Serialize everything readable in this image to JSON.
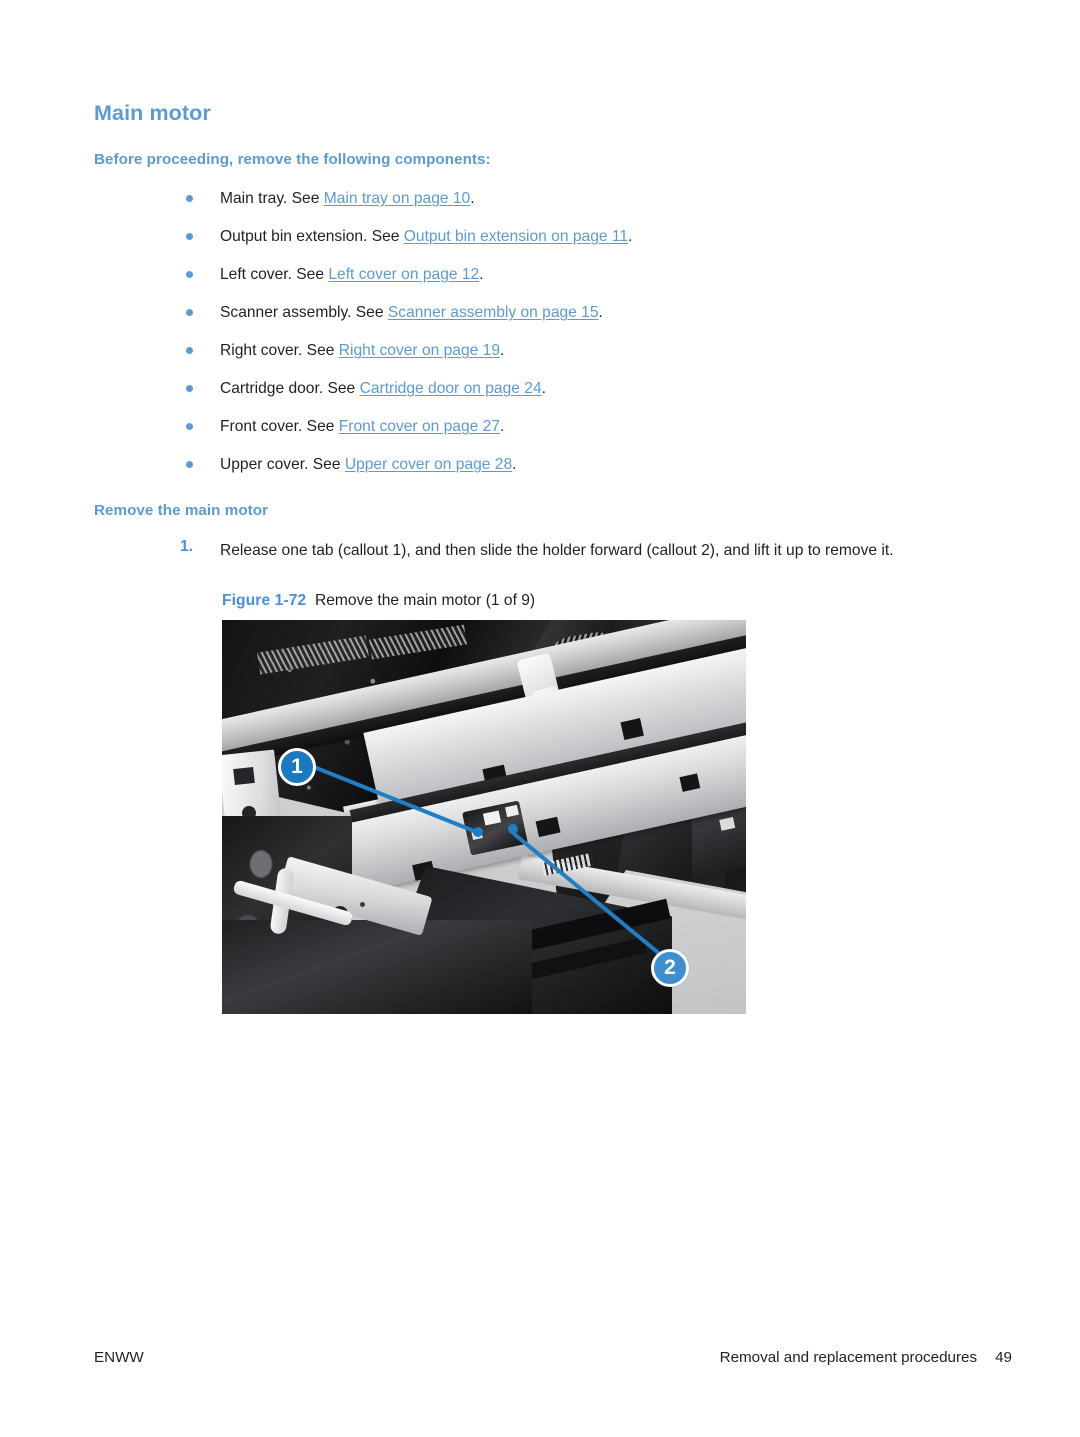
{
  "page": {
    "heading": "Main motor",
    "prereq_heading": "Before proceeding, remove the following components:",
    "remove_heading": "Remove the main motor"
  },
  "prerequisites": [
    {
      "lead": "Main tray. See ",
      "link": "Main tray on page 10",
      "tail": "."
    },
    {
      "lead": "Output bin extension. See ",
      "link": "Output bin extension on page 11",
      "tail": "."
    },
    {
      "lead": "Left cover. See ",
      "link": "Left cover on page 12",
      "tail": "."
    },
    {
      "lead": "Scanner assembly. See ",
      "link": "Scanner assembly on page 15",
      "tail": "."
    },
    {
      "lead": "Right cover. See ",
      "link": "Right cover on page 19",
      "tail": "."
    },
    {
      "lead": "Cartridge door. See ",
      "link": "Cartridge door on page 24",
      "tail": "."
    },
    {
      "lead": "Front cover. See ",
      "link": "Front cover on page 27",
      "tail": "."
    },
    {
      "lead": "Upper cover. See ",
      "link": "Upper cover on page 28",
      "tail": "."
    }
  ],
  "steps": [
    {
      "number": "1.",
      "text": "Release one tab (callout 1), and then slide the holder forward (callout 2), and lift it up to remove it."
    }
  ],
  "figure": {
    "label": "Figure 1-72",
    "title": "Remove the main motor (1 of 9)",
    "callouts": [
      {
        "number": "1"
      },
      {
        "number": "2"
      }
    ]
  },
  "footer": {
    "left": "ENWW",
    "section": "Removal and replacement procedures",
    "page_number": "49"
  },
  "colors": {
    "heading_blue": "#5b9bd5",
    "link_blue": "#5b9bd5",
    "callout_blue": "#1f7ec4",
    "body_text": "#231f20"
  }
}
